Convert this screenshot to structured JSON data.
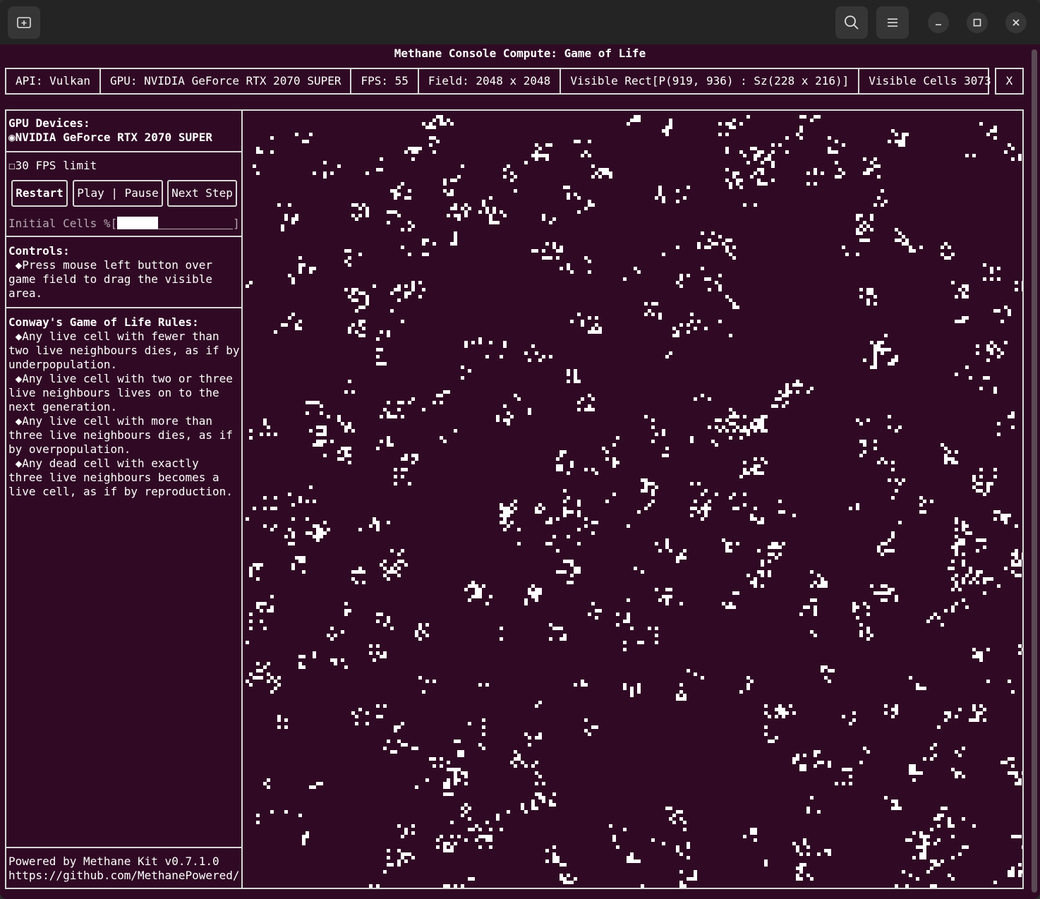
{
  "app": {
    "title": "Methane Console Compute: Game of Life"
  },
  "statusbar": {
    "api": "API: Vulkan",
    "gpu": "GPU: NVIDIA GeForce RTX 2070 SUPER",
    "fps": "FPS: 55",
    "field": "Field: 2048 x 2048",
    "visible_rect": "Visible Rect[P(919, 936) : Sz(228 x 216)]",
    "visible_cells": "Visible Cells 3073",
    "close_label": "X"
  },
  "panel": {
    "gpu_devices_title": "GPU Devices:",
    "gpu_device_label": "◉NVIDIA GeForce RTX 2070 SUPER",
    "fps_limit_label": "☐30 FPS limit",
    "restart_label": "Restart",
    "play_pause_label": "Play | Pause",
    "next_step_label": "Next Step",
    "initial_cells_label": "Initial Cells %[",
    "initial_cells_close": "]",
    "initial_cells_fraction": 0.35,
    "controls_title": "Controls:",
    "controls_lines": [
      " ◆Press mouse left button over",
      "game field to drag the visible",
      "area."
    ],
    "rules_title": "Conway's Game of Life Rules:",
    "rules_lines": [
      " ◆Any live cell with fewer than",
      "two live neighbours dies, as if by",
      "underpopulation.",
      " ◆Any live cell with two or three",
      "live neighbours lives on to the",
      "next generation.",
      " ◆Any live cell with more than",
      "three live neighbours dies, as if",
      "by overpopulation.",
      " ◆Any dead cell with exactly",
      "three live neighbours becomes a",
      "live cell, as if by reproduction."
    ],
    "footer_powered": "Powered by Methane Kit v0.7.1.0",
    "footer_url": "https://github.com/MethanePowered/"
  },
  "colors": {
    "background": "#300a24",
    "cell": "#ffffff",
    "border": "#d8d8d8",
    "titlebar": "#242424"
  },
  "icons": {
    "new_tab": "new-tab-icon",
    "search": "search-icon",
    "menu": "hamburger-menu-icon",
    "minimize": "minimize-icon",
    "maximize": "maximize-icon",
    "close": "close-icon"
  }
}
